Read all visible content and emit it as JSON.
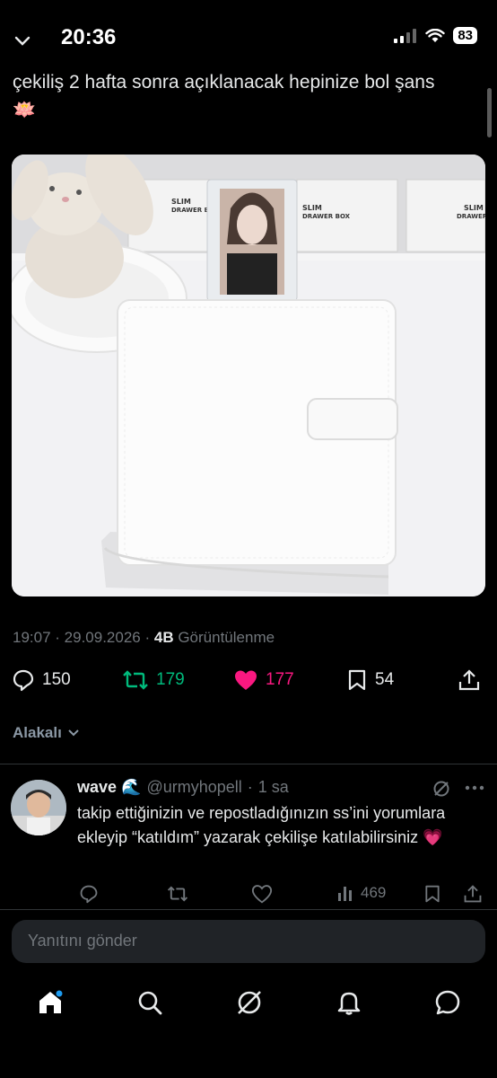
{
  "status": {
    "time": "20:36",
    "battery": "83"
  },
  "tweet": {
    "text": "çekiliş 2 hafta sonra açıklanacak hepinize bol şans 🪷",
    "time": "19:07",
    "date": "29.09.2026",
    "views_count": "4B",
    "views_label": "Görüntülenme",
    "media": {
      "box_label_1": "SLIM",
      "box_label_2": "DRAWER BOX"
    }
  },
  "actions": {
    "replies": "150",
    "reposts": "179",
    "likes": "177",
    "bookmarks": "54"
  },
  "related": {
    "label": "Alakalı"
  },
  "reply": {
    "name": "wave 🌊",
    "handle": "@urmyhopell",
    "time": "1 sa",
    "text": "takip ettiğinizin ve repostladığınızın ss’ini yorumlara ekleyip “katıldım” yazarak çekilişe katılabilirsiniz 💗",
    "views": "469"
  },
  "compose": {
    "placeholder": "Yanıtını gönder"
  },
  "colors": {
    "repost": "#00ba7c",
    "like": "#f91880",
    "muted": "#71767b",
    "text": "#e7e9ea"
  }
}
